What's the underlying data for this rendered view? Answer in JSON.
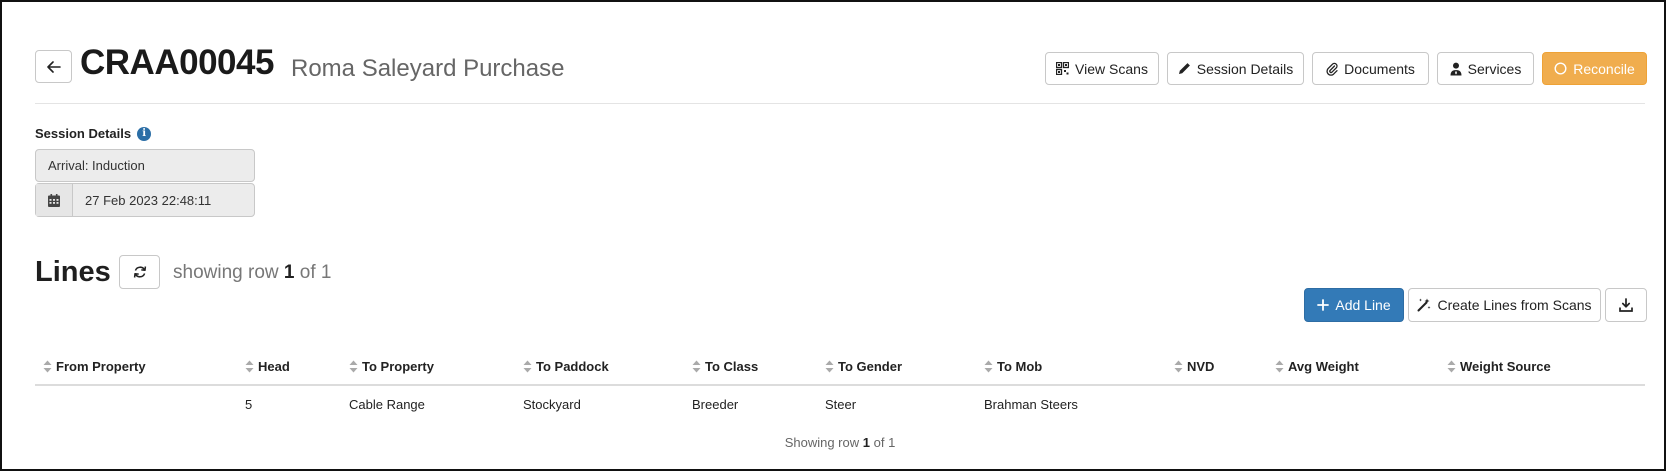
{
  "header": {
    "code": "CRAA00045",
    "name": "Roma Saleyard Purchase",
    "buttons": {
      "view_scans": "View Scans",
      "session_details": "Session Details",
      "documents": "Documents",
      "services": "Services",
      "reconcile": "Reconcile"
    }
  },
  "session_details": {
    "label": "Session Details",
    "type_value": "Arrival: Induction",
    "datetime_value": "27 Feb 2023 22:48:11"
  },
  "lines": {
    "title": "Lines",
    "showing_prefix": "showing row",
    "showing_current": "1",
    "showing_suffix": "of 1",
    "buttons": {
      "add_line": "Add Line",
      "create_from_scans": "Create Lines from Scans"
    },
    "columns": [
      "From Property",
      "Head",
      "To Property",
      "To Paddock",
      "To Class",
      "To Gender",
      "To Mob",
      "NVD",
      "Avg Weight",
      "Weight Source"
    ],
    "rows": [
      [
        "",
        "5",
        "Cable Range",
        "Stockyard",
        "Breeder",
        "Steer",
        "Brahman Steers",
        "",
        "",
        ""
      ]
    ],
    "footer_prefix": "Showing row",
    "footer_current": "1",
    "footer_suffix": "of 1"
  },
  "colors": {
    "primary": "#337ab7",
    "warning": "#f0ad4e",
    "info": "#2b6ea6"
  }
}
